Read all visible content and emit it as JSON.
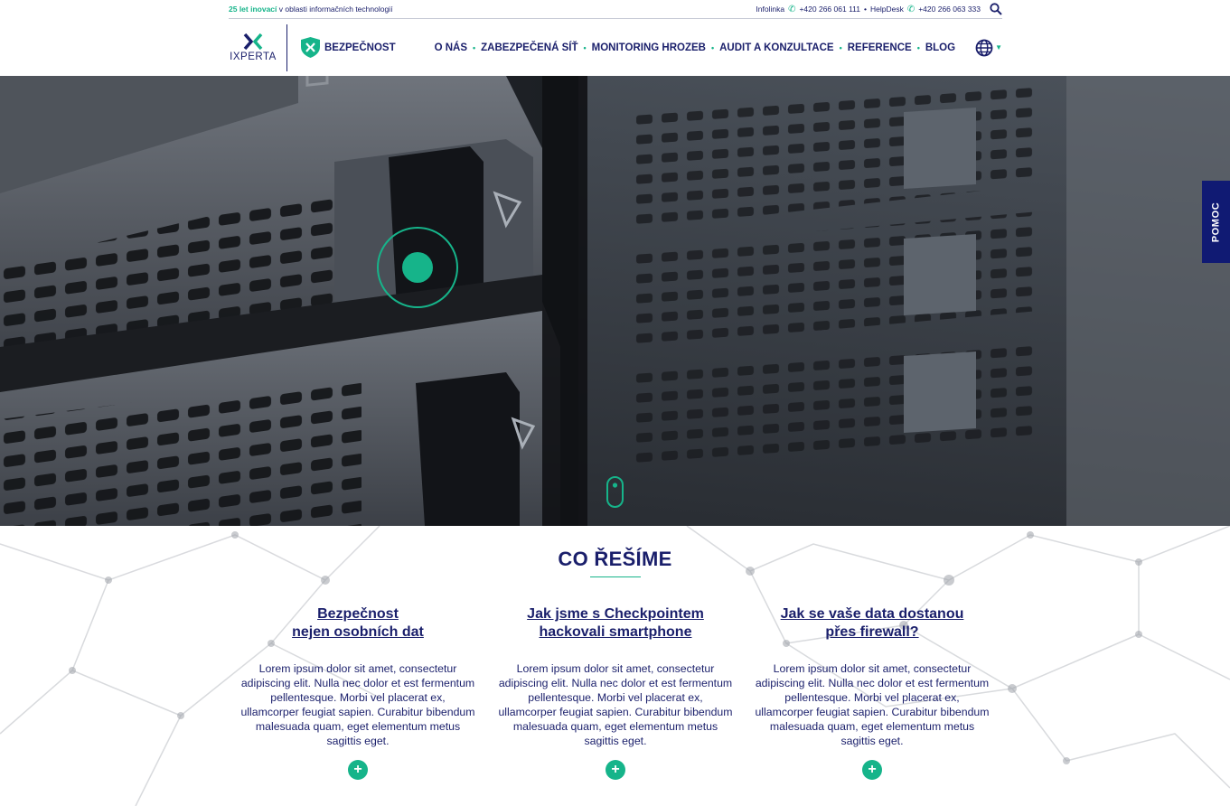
{
  "topbar": {
    "tagline_highlight": "25 let inovací",
    "tagline_rest": " v oblasti informačních technologií",
    "infolinka_label": "Infolinka",
    "infolinka_phone": "+420 266 061 111",
    "separator": "•",
    "helpdesk_label": "HelpDesk",
    "helpdesk_phone": "+420 266 063 333",
    "icons": {
      "phone": "phone-icon",
      "search": "search-icon"
    }
  },
  "header": {
    "logo_text": "IXPERTA",
    "brand_label": "BEZPEČNOST",
    "nav": [
      {
        "label": "O NÁS"
      },
      {
        "label": "ZABEZPEČENÁ SÍŤ"
      },
      {
        "label": "MONITORING HROZEB"
      },
      {
        "label": "AUDIT A KONZULTACE"
      },
      {
        "label": "REFERENCE"
      },
      {
        "label": "BLOG"
      }
    ],
    "nav_separator": "•",
    "language_icon": "globe-icon"
  },
  "sidebar_tab": {
    "label": "POMOC"
  },
  "section": {
    "title": "CO ŘEŠÍME",
    "columns": [
      {
        "title_line1": "Bezpečnost",
        "title_line2": "nejen osobních dat",
        "text": "Lorem ipsum dolor sit amet, consectetur adipiscing elit. Nulla nec dolor et est fermentum pellentesque. Morbi vel placerat ex, ullamcorper feugiat sapien. Curabitur bibendum malesuada quam, eget elementum metus sagittis eget.",
        "button": "+"
      },
      {
        "title_line1": "Jak jsme s Checkpointem",
        "title_line2": "hackovali smartphone",
        "text": "Lorem ipsum dolor sit amet, consectetur adipiscing elit. Nulla nec dolor et est fermentum pellentesque. Morbi vel placerat ex, ullamcorper feugiat sapien. Curabitur bibendum malesuada quam, eget elementum metus sagittis eget.",
        "button": "+"
      },
      {
        "title_line1": "Jak se vaše data dostanou",
        "title_line2": "přes firewall?",
        "text": "Lorem ipsum dolor sit amet, consectetur adipiscing elit. Nulla nec dolor et est fermentum pellentesque. Morbi vel placerat ex, ullamcorper feugiat sapien. Curabitur bibendum malesuada quam, eget elementum metus sagittis eget.",
        "button": "+"
      }
    ]
  },
  "colors": {
    "navy": "#1a1f6b",
    "green": "#16b48a",
    "tab": "#101a73"
  }
}
